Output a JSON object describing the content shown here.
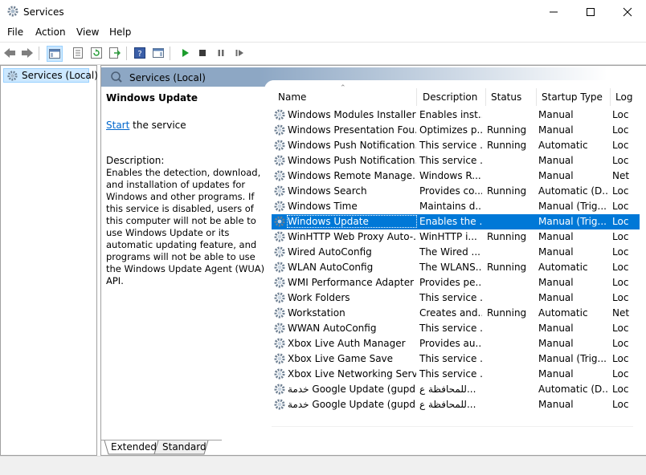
{
  "window": {
    "title": "Services"
  },
  "menu": [
    "File",
    "Action",
    "View",
    "Help"
  ],
  "tree": {
    "item": "Services (Local)"
  },
  "pane": {
    "header": "Services (Local)",
    "selected_title": "Windows Update",
    "start_link": "Start",
    "start_suffix": " the service",
    "desc_label": "Description:",
    "desc_text": "Enables the detection, download, and installation of updates for Windows and other programs. If this service is disabled, users of this computer will not be able to use Windows Update or its automatic updating feature, and programs will not be able to use the Windows Update Agent (WUA) API."
  },
  "columns": [
    "Name",
    "Description",
    "Status",
    "Startup Type",
    "Log"
  ],
  "rows": [
    {
      "name": "Windows Modules Installer",
      "desc": "Enables inst...",
      "status": "",
      "startup": "Manual",
      "logon": "Loc"
    },
    {
      "name": "Windows Presentation Fou...",
      "desc": "Optimizes p...",
      "status": "Running",
      "startup": "Manual",
      "logon": "Loc"
    },
    {
      "name": "Windows Push Notification...",
      "desc": "This service ...",
      "status": "Running",
      "startup": "Automatic",
      "logon": "Loc"
    },
    {
      "name": "Windows Push Notification...",
      "desc": "This service ...",
      "status": "",
      "startup": "Manual",
      "logon": "Loc"
    },
    {
      "name": "Windows Remote Manage...",
      "desc": "Windows R...",
      "status": "",
      "startup": "Manual",
      "logon": "Net"
    },
    {
      "name": "Windows Search",
      "desc": "Provides co...",
      "status": "Running",
      "startup": "Automatic (D...",
      "logon": "Loc"
    },
    {
      "name": "Windows Time",
      "desc": "Maintains d...",
      "status": "",
      "startup": "Manual (Trig...",
      "logon": "Loc"
    },
    {
      "name": "Windows Update",
      "desc": "Enables the ...",
      "status": "",
      "startup": "Manual (Trig...",
      "logon": "Loc",
      "selected": true
    },
    {
      "name": "WinHTTP Web Proxy Auto-...",
      "desc": "WinHTTP i...",
      "status": "Running",
      "startup": "Manual",
      "logon": "Loc"
    },
    {
      "name": "Wired AutoConfig",
      "desc": "The Wired ...",
      "status": "",
      "startup": "Manual",
      "logon": "Loc"
    },
    {
      "name": "WLAN AutoConfig",
      "desc": "The WLANS...",
      "status": "Running",
      "startup": "Automatic",
      "logon": "Loc"
    },
    {
      "name": "WMI Performance Adapter",
      "desc": "Provides pe...",
      "status": "",
      "startup": "Manual",
      "logon": "Loc"
    },
    {
      "name": "Work Folders",
      "desc": "This service ...",
      "status": "",
      "startup": "Manual",
      "logon": "Loc"
    },
    {
      "name": "Workstation",
      "desc": "Creates and...",
      "status": "Running",
      "startup": "Automatic",
      "logon": "Net"
    },
    {
      "name": "WWAN AutoConfig",
      "desc": "This service ...",
      "status": "",
      "startup": "Manual",
      "logon": "Loc"
    },
    {
      "name": "Xbox Live Auth Manager",
      "desc": "Provides au...",
      "status": "",
      "startup": "Manual",
      "logon": "Loc"
    },
    {
      "name": "Xbox Live Game Save",
      "desc": "This service ...",
      "status": "",
      "startup": "Manual (Trig...",
      "logon": "Loc"
    },
    {
      "name": "Xbox Live Networking Service",
      "desc": "This service ...",
      "status": "",
      "startup": "Manual",
      "logon": "Loc"
    },
    {
      "name": "خدمة Google Update (gupd...",
      "desc": "للمحافظة ع...",
      "status": "",
      "startup": "Automatic (D...",
      "logon": "Loc"
    },
    {
      "name": "خدمة Google Update (gupd...",
      "desc": "للمحافظة ع...",
      "status": "",
      "startup": "Manual",
      "logon": "Loc"
    }
  ],
  "tabs": [
    "Extended",
    "Standard"
  ],
  "colors": {
    "selection": "#0078d7",
    "pane_header": "#8da7c4",
    "link": "#0066cc"
  }
}
